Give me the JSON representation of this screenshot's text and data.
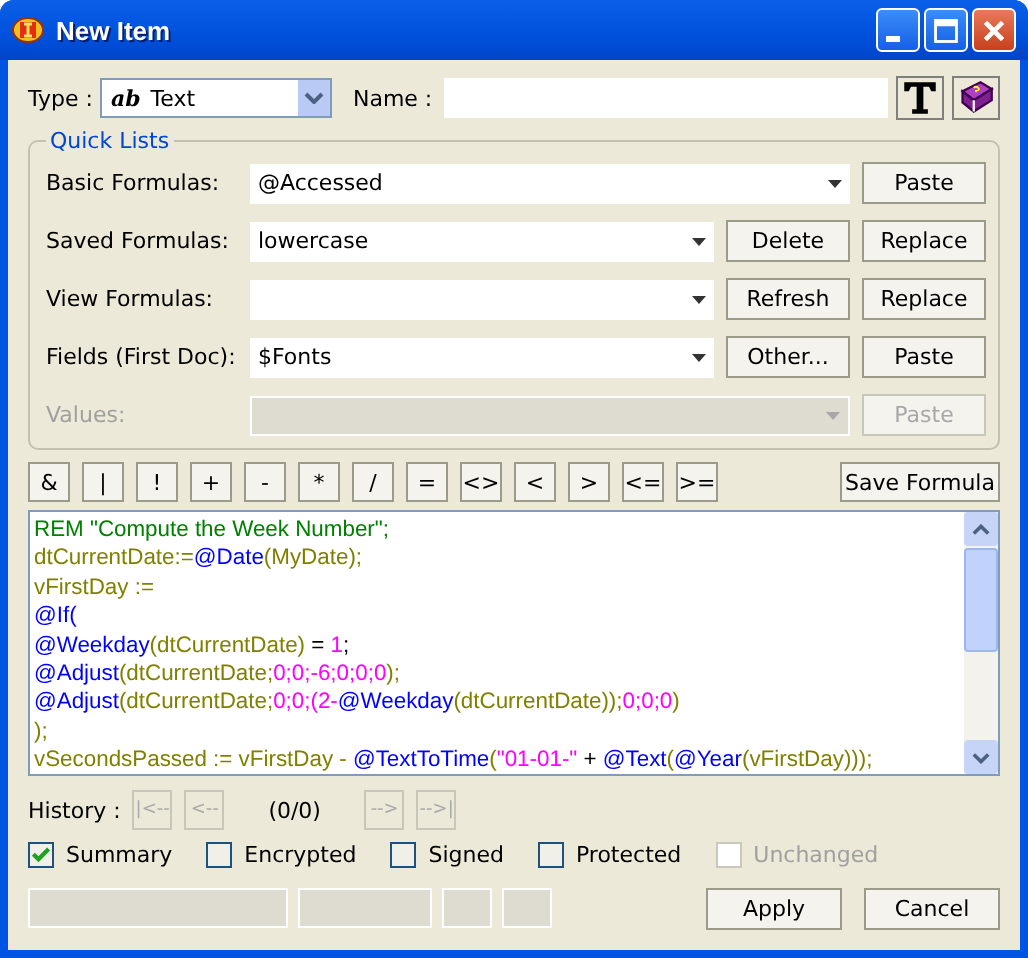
{
  "window": {
    "title": "New Item"
  },
  "type_field": {
    "label": "Type :",
    "icon_text": "ab",
    "value": "Text"
  },
  "name_field": {
    "label": "Name :"
  },
  "quick_lists": {
    "title": "Quick Lists",
    "rows": [
      {
        "label": "Basic Formulas:",
        "value": "@Accessed",
        "disabled": false,
        "buttons": [
          {
            "label": "Paste",
            "disabled": false
          }
        ]
      },
      {
        "label": "Saved Formulas:",
        "value": "lowercase",
        "disabled": false,
        "buttons": [
          {
            "label": "Delete",
            "disabled": false
          },
          {
            "label": "Replace",
            "disabled": false
          }
        ]
      },
      {
        "label": "View Formulas:",
        "disabled": false,
        "buttons": [
          {
            "label": "Refresh",
            "disabled": false
          },
          {
            "label": "Replace",
            "disabled": false
          }
        ]
      },
      {
        "label": "Fields (First Doc):",
        "value": "$Fonts",
        "disabled": false,
        "buttons": [
          {
            "label": "Other...",
            "disabled": false
          },
          {
            "label": "Paste",
            "disabled": false
          }
        ]
      },
      {
        "label": "Values:",
        "disabled": true,
        "buttons": [
          {
            "label": "Paste",
            "disabled": true
          }
        ]
      }
    ]
  },
  "operators": [
    "&",
    "|",
    "!",
    "+",
    "-",
    "*",
    "/",
    "=",
    "<>",
    "<",
    ">",
    "<=",
    ">="
  ],
  "save_formula": "Save Formula",
  "code_lines": [
    [
      {
        "kind": "comment",
        "text": "REM \"Compute the Week Number\";"
      }
    ],
    [
      {
        "kind": "var",
        "text": "dtCurrentDate:="
      },
      {
        "kind": "func",
        "text": "@Date"
      },
      {
        "kind": "var",
        "text": "(MyDate);"
      }
    ],
    [
      {
        "kind": "var",
        "text": "vFirstDay :="
      }
    ],
    [
      {
        "kind": "func",
        "text": "@If("
      }
    ],
    [
      {
        "kind": "func",
        "text": "@Weekday"
      },
      {
        "kind": "var",
        "text": "(dtCurrentDate)"
      },
      {
        "kind": "punct",
        "text": " = "
      },
      {
        "kind": "num",
        "text": "1"
      },
      {
        "kind": "punct",
        "text": ";"
      }
    ],
    [
      {
        "kind": "func",
        "text": "@Adjust"
      },
      {
        "kind": "var",
        "text": "(dtCurrentDate;"
      },
      {
        "kind": "num",
        "text": "0;0;-6;0;0;0"
      },
      {
        "kind": "var",
        "text": ");"
      }
    ],
    [
      {
        "kind": "func",
        "text": "@Adjust"
      },
      {
        "kind": "var",
        "text": "(dtCurrentDate;"
      },
      {
        "kind": "num",
        "text": "0;0;(2-"
      },
      {
        "kind": "func",
        "text": "@Weekday"
      },
      {
        "kind": "var",
        "text": "(dtCurrentDate));"
      },
      {
        "kind": "num",
        "text": "0;0;0"
      },
      {
        "kind": "var",
        "text": ")"
      }
    ],
    [
      {
        "kind": "var",
        "text": ");"
      }
    ],
    [
      {
        "kind": "var",
        "text": "vSecondsPassed := vFirstDay - "
      },
      {
        "kind": "func",
        "text": "@TextToTime"
      },
      {
        "kind": "var",
        "text": "("
      },
      {
        "kind": "num",
        "text": "\"01-01-\""
      },
      {
        "kind": "punct",
        "text": " + "
      },
      {
        "kind": "func",
        "text": "@Text"
      },
      {
        "kind": "var",
        "text": "("
      },
      {
        "kind": "func",
        "text": "@Year"
      },
      {
        "kind": "var",
        "text": "(vFirstDay)));"
      }
    ]
  ],
  "history": {
    "label": "History :",
    "buttons": [
      {
        "label": "|<--",
        "disabled": true
      },
      {
        "label": "<--",
        "disabled": true
      },
      {
        "label": "-->",
        "disabled": true
      },
      {
        "label": "-->|",
        "disabled": true
      }
    ],
    "count": "(0/0)"
  },
  "checkboxes": [
    {
      "label": "Summary",
      "checked": true,
      "disabled": false
    },
    {
      "label": "Encrypted",
      "checked": false,
      "disabled": false
    },
    {
      "label": "Signed",
      "checked": false,
      "disabled": false
    },
    {
      "label": "Protected",
      "checked": false,
      "disabled": false
    },
    {
      "label": "Unchanged",
      "checked": false,
      "disabled": true
    }
  ],
  "buttons": [
    "Apply",
    "Cancel"
  ]
}
